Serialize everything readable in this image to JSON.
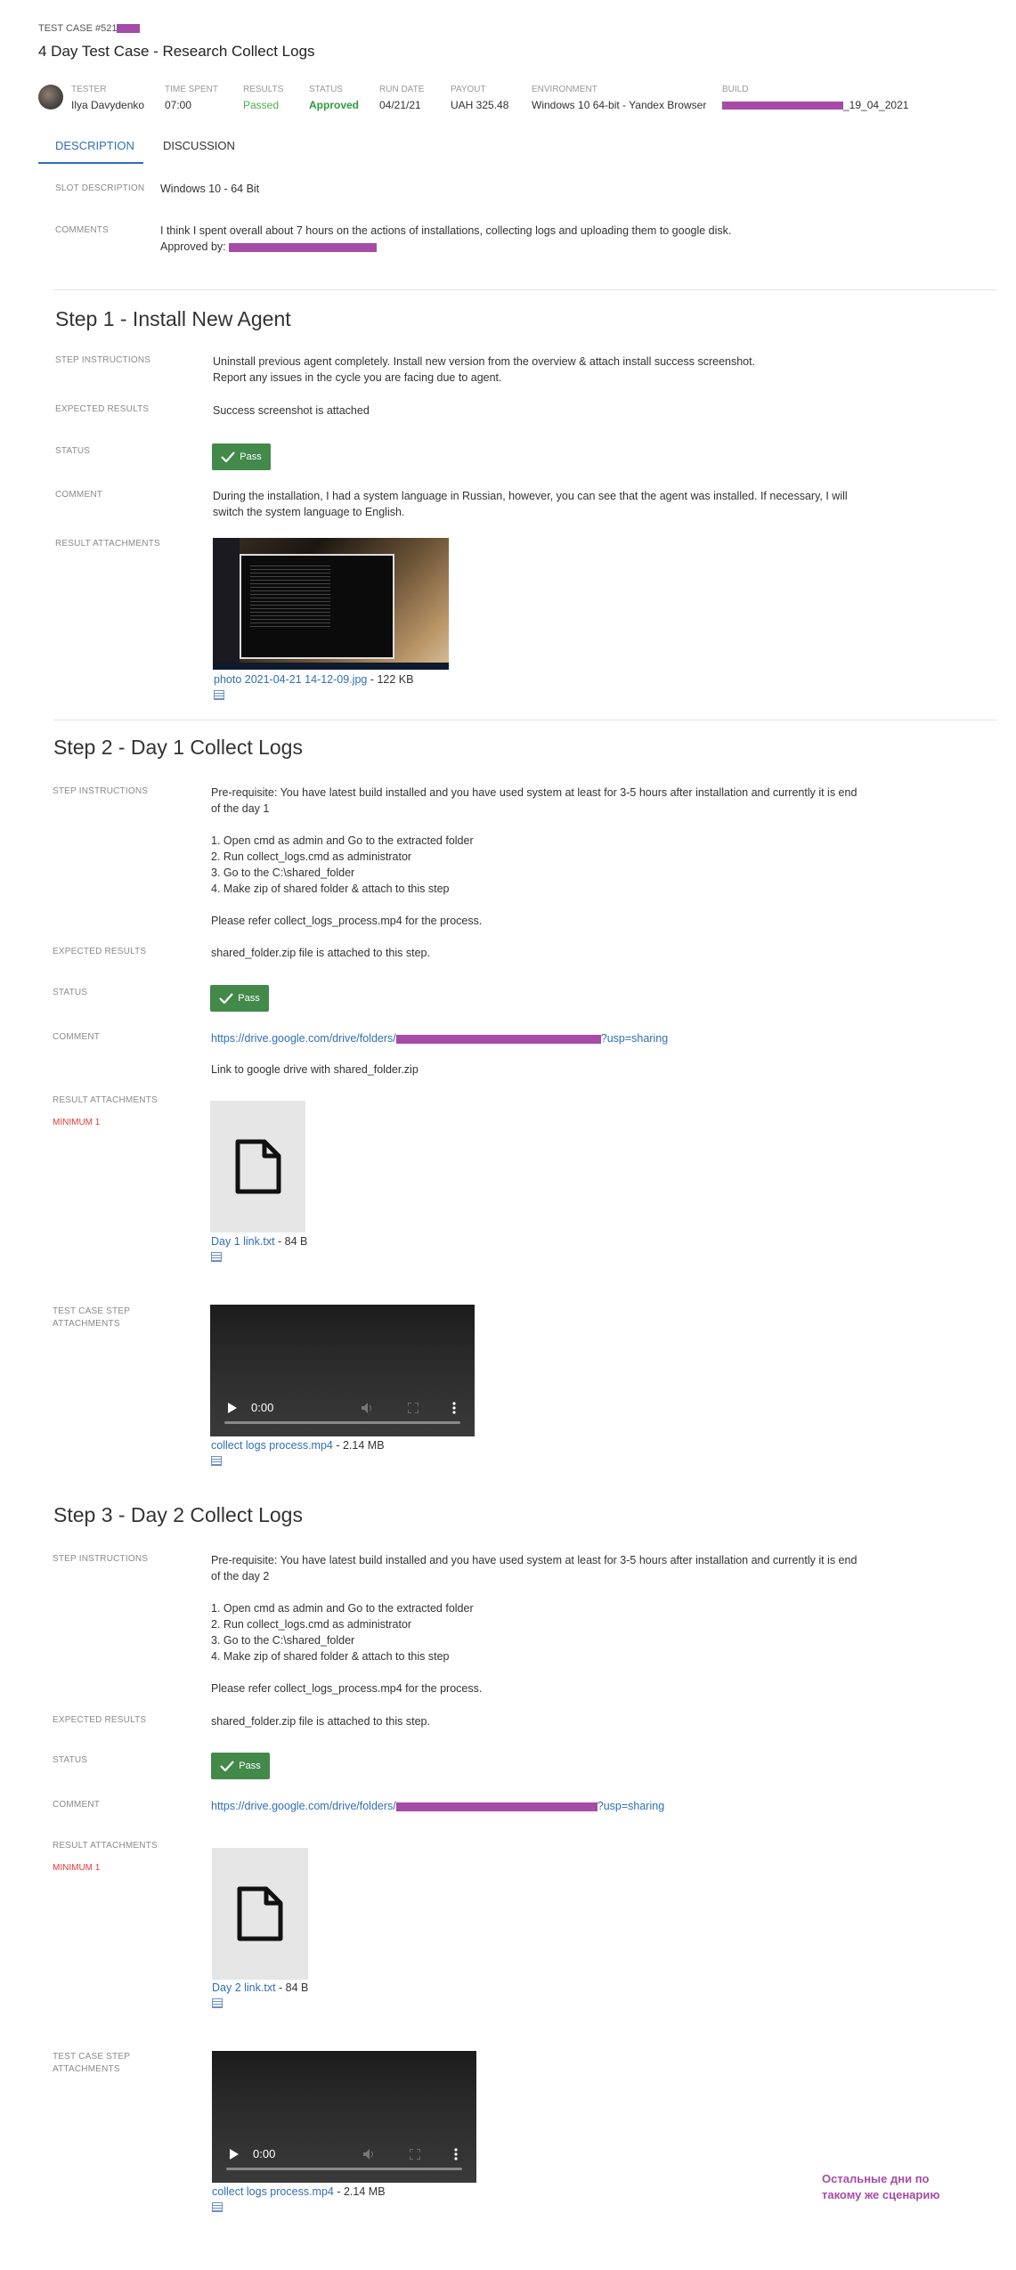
{
  "header": {
    "case_id": "TEST CASE #521",
    "title": "4 Day Test Case - Research Collect Logs",
    "fields": {
      "tester_label": "TESTER",
      "tester": "Ilya Davydenko",
      "time_label": "TIME SPENT",
      "time": "07:00",
      "results_label": "RESULTS",
      "results": "Passed",
      "status_label": "STATUS",
      "status": "Approved",
      "run_label": "RUN DATE",
      "run": "04/21/21",
      "payout_label": "PAYOUT",
      "payout": "UAH 325.48",
      "env_label": "ENVIRONMENT",
      "env": "Windows 10 64-bit - Yandex Browser",
      "build_label": "BUILD",
      "build_suffix": "_19_04_2021"
    }
  },
  "tabs": [
    "DESCRIPTION",
    "DISCUSSION"
  ],
  "slot": {
    "slot_label": "SLOT DESCRIPTION",
    "slot_value": "Windows 10 - 64 Bit",
    "comments_label": "COMMENTS",
    "comments_line1": "I think I spent overall about 7 hours on the actions of installations, collecting logs and uploading them to google disk.",
    "approved_by": "Approved by:"
  },
  "labels": {
    "instructions": "STEP INSTRUCTIONS",
    "expected": "EXPECTED RESULTS",
    "status": "STATUS",
    "comment": "COMMENT",
    "attachments": "RESULT ATTACHMENTS",
    "minimum": "MINIMUM 1",
    "case_attach_1": "TEST CASE STEP",
    "case_attach_2": "ATTACHMENTS",
    "pass": "Pass"
  },
  "step1": {
    "title": "Step 1 - Install New Agent",
    "instr1": "Uninstall previous agent completely. Install new version from the overview & attach install success screenshot.",
    "instr2": "Report any issues in the cycle you are facing due to agent.",
    "expected": "Success screenshot is attached",
    "comment1": "During the installation, I had a system language in Russian, however, you can see that the agent was installed. If necessary, I will",
    "comment2": "switch the system language to English.",
    "file": "photo 2021-04-21 14-12-09.jpg",
    "size": " - 122 KB"
  },
  "step2": {
    "title": "Step 2 - Day 1 Collect Logs",
    "prereq1": "Pre-requisite: You have latest build installed and you have used system at least for 3-5 hours after installation and currently it is end",
    "prereq2": "of the day 1",
    "list": [
      "1. Open cmd as admin and Go to the extracted folder",
      "2. Run collect_logs.cmd as administrator",
      "3. Go to the C:\\shared_folder",
      "4. Make zip of shared folder & attach to this step"
    ],
    "refer": "Please refer collect_logs_process.mp4 for the process.",
    "expected": "shared_folder.zip file is attached to this step.",
    "link_start": "https://drive.google.com/drive/folders/",
    "link_end": "?usp=sharing",
    "comment2": "Link to google drive with shared_folder.zip",
    "file": "Day 1 link.txt",
    "size": " - 84 B",
    "video_file": "collect logs process.mp4",
    "video_size": " - 2.14 MB",
    "video_time": "0:00"
  },
  "step3": {
    "title": "Step 3 - Day 2 Collect Logs",
    "prereq1": "Pre-requisite: You have latest build installed and you have used system at least for 3-5 hours after installation and currently it is end",
    "prereq2": "of the day 2",
    "list": [
      "1. Open cmd as admin and Go to the extracted folder",
      "2. Run collect_logs.cmd as administrator",
      "3. Go to the C:\\shared_folder",
      "4. Make zip of shared folder & attach to this step"
    ],
    "refer": "Please refer collect_logs_process.mp4 for the process.",
    "expected": "shared_folder.zip file is attached to this step.",
    "link_start": "https://drive.google.com/drive/folders/",
    "link_end": "?usp=sharing",
    "file": "Day 2 link.txt",
    "size": " - 84 B",
    "video_file": "collect logs process.mp4",
    "video_size": " - 2.14 MB",
    "video_time": "0:00"
  },
  "note": {
    "line1": "Остальные дни по",
    "line2": "такому же сценарию"
  },
  "colors": {
    "accent": "#2f6fb7",
    "pass": "#43894a",
    "redact": "#a64ca6",
    "minimum": "#e53935"
  }
}
